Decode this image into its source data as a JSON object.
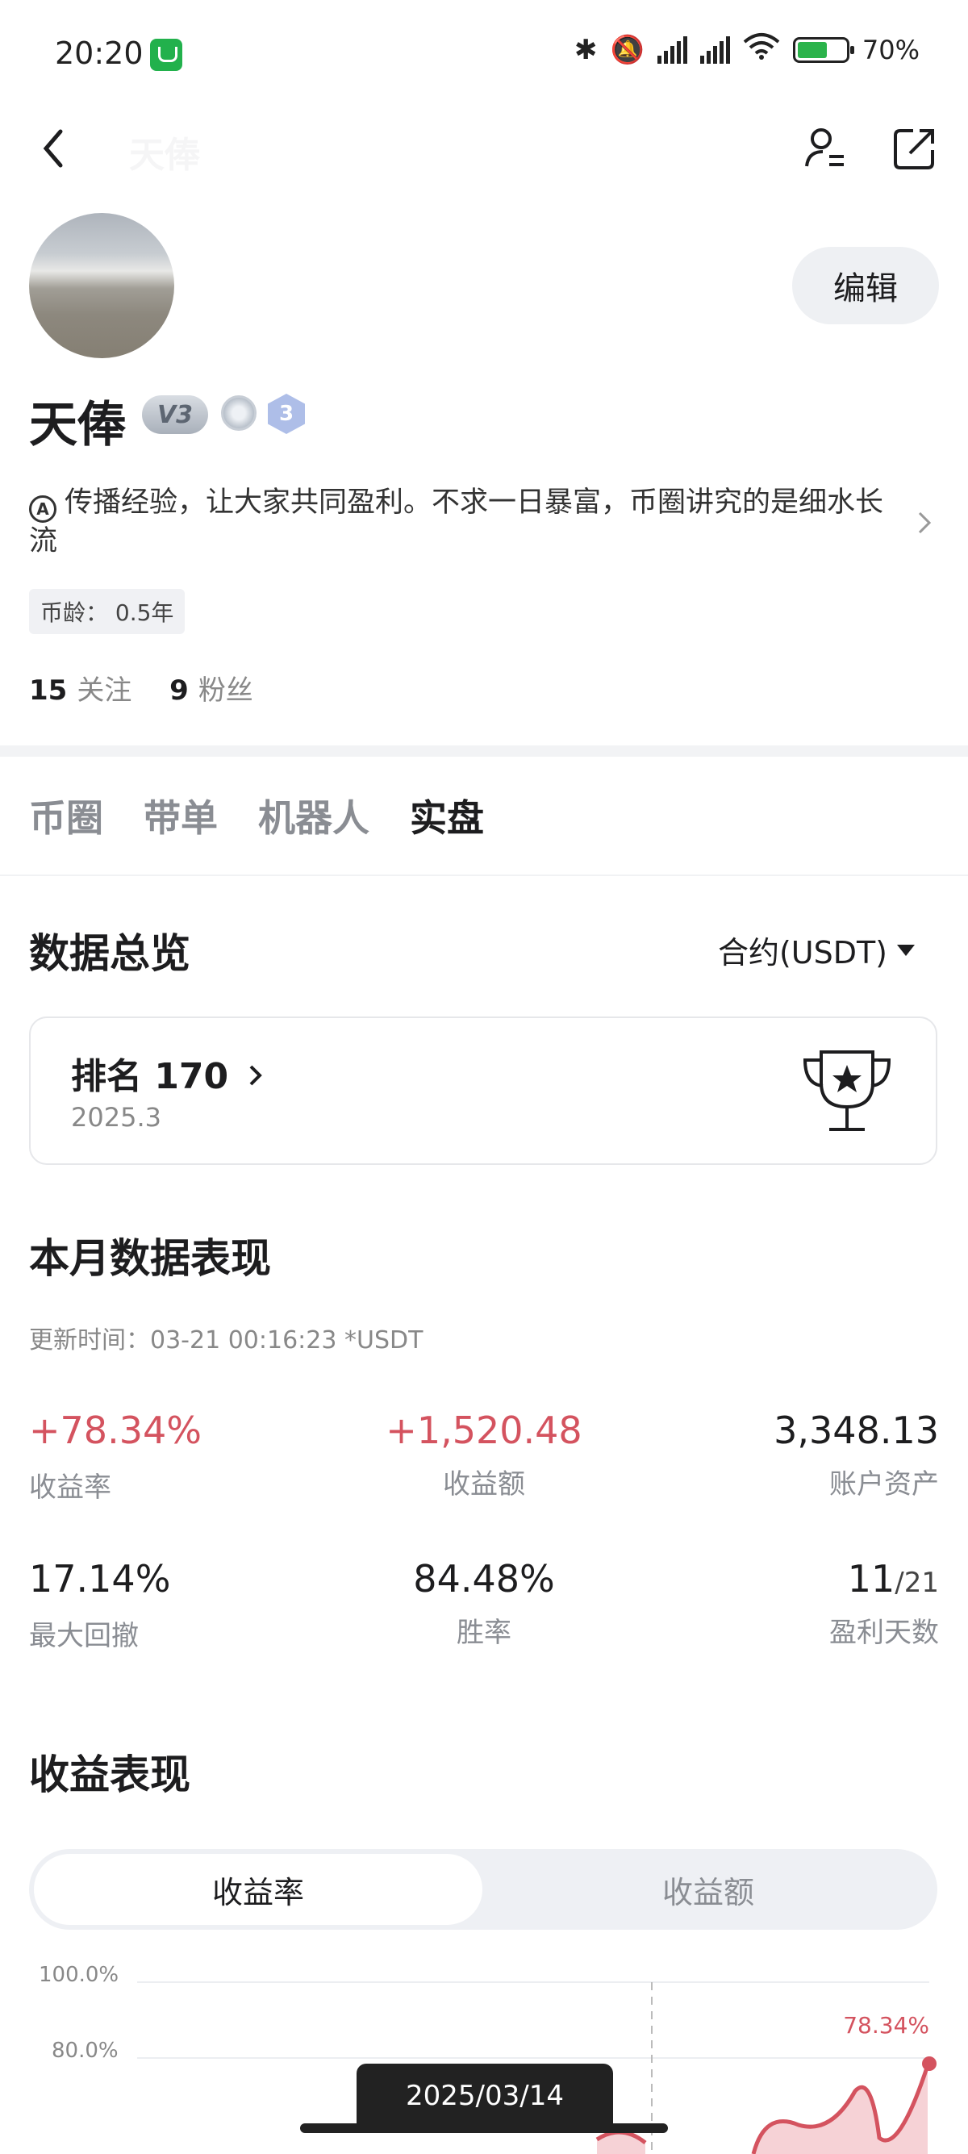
{
  "status_bar": {
    "time": "20:20",
    "battery": "70%"
  },
  "header": {
    "back_icon": "chevron-left-icon",
    "ghost_title": "天俸"
  },
  "profile": {
    "name": "天俸",
    "vip_badge": "V3",
    "level_badge": "3",
    "edit_label": "编辑",
    "bio": "传播经验，让大家共同盈利。不求一日暴富，币圈讲究的是细水长流",
    "coin_age": "币龄：  0.5年",
    "following_count": "15",
    "following_label": "关注",
    "followers_count": "9",
    "followers_label": "粉丝"
  },
  "tabs": [
    {
      "label": "币圈",
      "active": false
    },
    {
      "label": "带单",
      "active": false
    },
    {
      "label": "机器人",
      "active": false
    },
    {
      "label": "实盘",
      "active": true
    }
  ],
  "overview": {
    "title": "数据总览",
    "dropdown": "合约(USDT)",
    "rank_label": "排名 170",
    "rank_period": "2025.3"
  },
  "monthly": {
    "title": "本月数据表现",
    "update_time": "更新时间：03-21 00:16:23  *USDT",
    "stats": [
      {
        "value": "+78.34%",
        "label": "收益率",
        "positive": true
      },
      {
        "value": "+1,520.48",
        "label": "收益额",
        "positive": true
      },
      {
        "value": "3,348.13",
        "label": "账户资产",
        "positive": false
      },
      {
        "value": "17.14%",
        "label": "最大回撤",
        "positive": false
      },
      {
        "value": "84.48%",
        "label": "胜率",
        "positive": false
      },
      {
        "value": "11",
        "value_suffix": "/21",
        "label": "盈利天数",
        "positive": false
      }
    ]
  },
  "returns": {
    "title": "收益表现",
    "seg_active": "收益率",
    "seg_inactive": "收益额",
    "tooltip_date": "2025/03/14"
  },
  "chart_data": {
    "type": "area",
    "y_ticks": [
      "100.0%",
      "80.0%"
    ],
    "ylim": [
      80,
      100
    ],
    "last_value_label": "78.34%",
    "last_value": 78.34,
    "color": "#d4535f"
  }
}
